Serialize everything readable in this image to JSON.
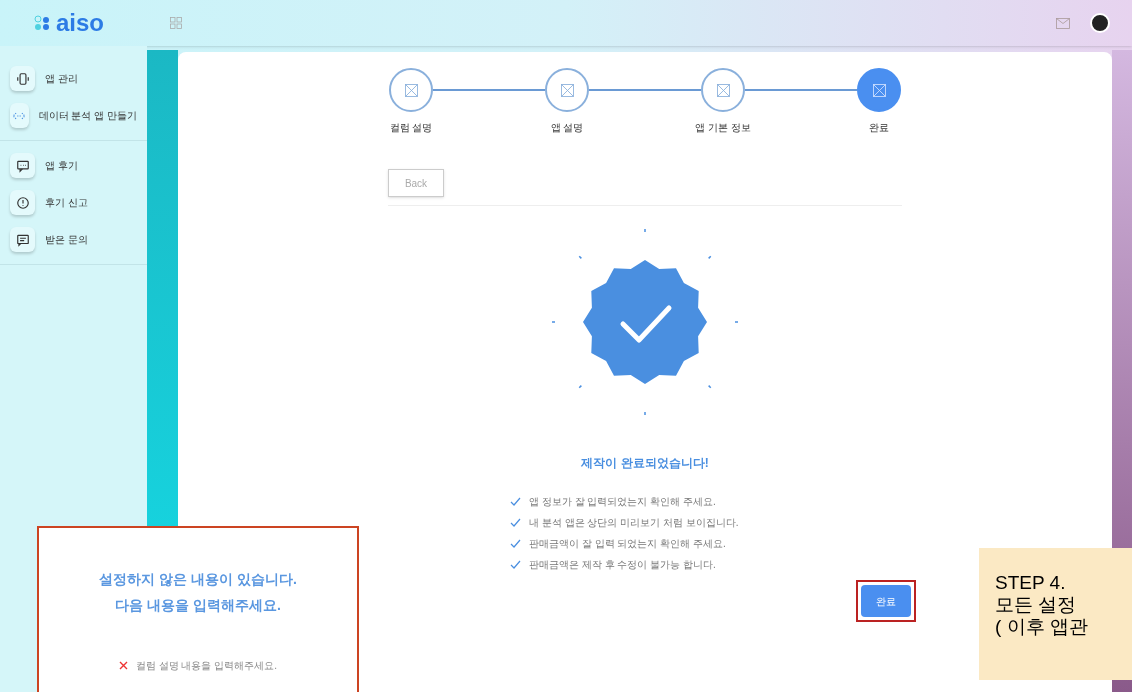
{
  "header": {
    "logo": "aiso"
  },
  "sidebar": {
    "groups": [
      {
        "items": [
          {
            "label": "앱 관리",
            "kind": "phone"
          },
          {
            "label": "데이터 분석 앱 만들기",
            "kind": "code"
          }
        ]
      },
      {
        "items": [
          {
            "label": "앱 후기",
            "kind": "chat"
          },
          {
            "label": "후기 신고",
            "kind": "alert"
          },
          {
            "label": "받은 문의",
            "kind": "message"
          }
        ]
      }
    ]
  },
  "stepper": {
    "steps": [
      {
        "label": "컬럼 설명",
        "selected": false
      },
      {
        "label": "앱 설명",
        "selected": false
      },
      {
        "label": "앱 기본 정보",
        "selected": false
      },
      {
        "label": "완료",
        "selected": true
      }
    ]
  },
  "back_button": "Back",
  "complete": {
    "title": "제작이 완료되었습니다!",
    "checklist": [
      "앱 정보가 잘 입력되었는지 확인해 주세요.",
      "내 분석 앱은 상단의 미리보기 처럼 보이집니다.",
      "판매금액이 잘 입력 되었는지 확인해 주세요.",
      "판매금액은 제작 후 수정이 불가능 합니다."
    ],
    "button": "완료"
  },
  "popup": {
    "title_lines": [
      "설정하지 않은 내용이 있습니다.",
      "다음 내용을 입력해주세요."
    ],
    "errors": [
      "컬럼 설명 내용을 입력해주세요."
    ]
  },
  "note": {
    "lines": [
      "STEP 4.",
      "모든 설정",
      "( 이후 앱관"
    ]
  }
}
